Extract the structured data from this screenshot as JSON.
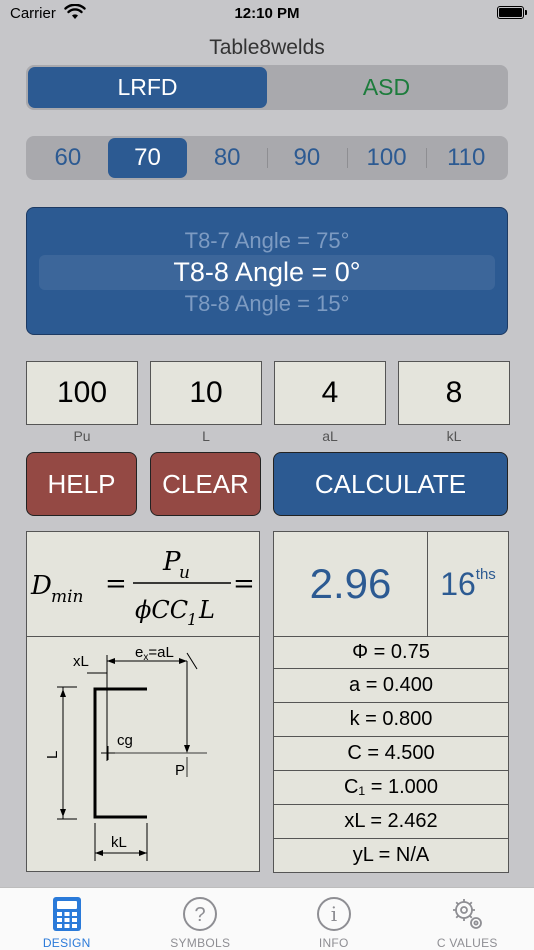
{
  "status": {
    "carrier": "Carrier",
    "time": "12:10 PM"
  },
  "title": "Table8welds",
  "method": {
    "options": [
      "LRFD",
      "ASD"
    ],
    "selected": "LRFD"
  },
  "strength": {
    "options": [
      "60",
      "70",
      "80",
      "90",
      "100",
      "110"
    ],
    "selected": "70"
  },
  "picker": {
    "above": "T8-7  Angle = 75°",
    "selected": "T8-8  Angle = 0°",
    "below": "T8-8  Angle = 15°"
  },
  "inputs": [
    {
      "value": "100",
      "label": "Pu"
    },
    {
      "value": "10",
      "label": "L"
    },
    {
      "value": "4",
      "label": "aL"
    },
    {
      "value": "8",
      "label": "kL"
    }
  ],
  "buttons": {
    "help": "HELP",
    "clear": "CLEAR",
    "calculate": "CALCULATE"
  },
  "formula": {
    "lhs": "D",
    "lhs_sub": "min",
    "numerator": "P",
    "numerator_sub": "u",
    "denominator": "ϕCC",
    "denominator_sub": "1",
    "denominator_tail": "L"
  },
  "diagram": {
    "ex_label": "e",
    "ex_sub": "x",
    "ex_rest": "=aL",
    "xL": "xL",
    "L": "L",
    "cg": "cg",
    "P": "P",
    "kL": "kL"
  },
  "result": {
    "value": "2.96",
    "unit": "16",
    "unit_sup": "ths"
  },
  "values": [
    "Φ = 0.75",
    "a = 0.400",
    "k = 0.800",
    "C = 4.500",
    "C₁ = 1.000",
    "xL = 2.462",
    "yL = N/A"
  ],
  "tabs": [
    {
      "label": "DESIGN",
      "icon": "calculator-icon",
      "active": true
    },
    {
      "label": "SYMBOLS",
      "icon": "question-icon",
      "active": false
    },
    {
      "label": "INFO",
      "icon": "info-icon",
      "active": false
    },
    {
      "label": "C VALUES",
      "icon": "gear-icon",
      "active": false
    }
  ],
  "colors": {
    "accent": "#2c5a92",
    "danger": "#944944",
    "asd": "#1d7c3c",
    "tab_active": "#2a7ad9"
  }
}
